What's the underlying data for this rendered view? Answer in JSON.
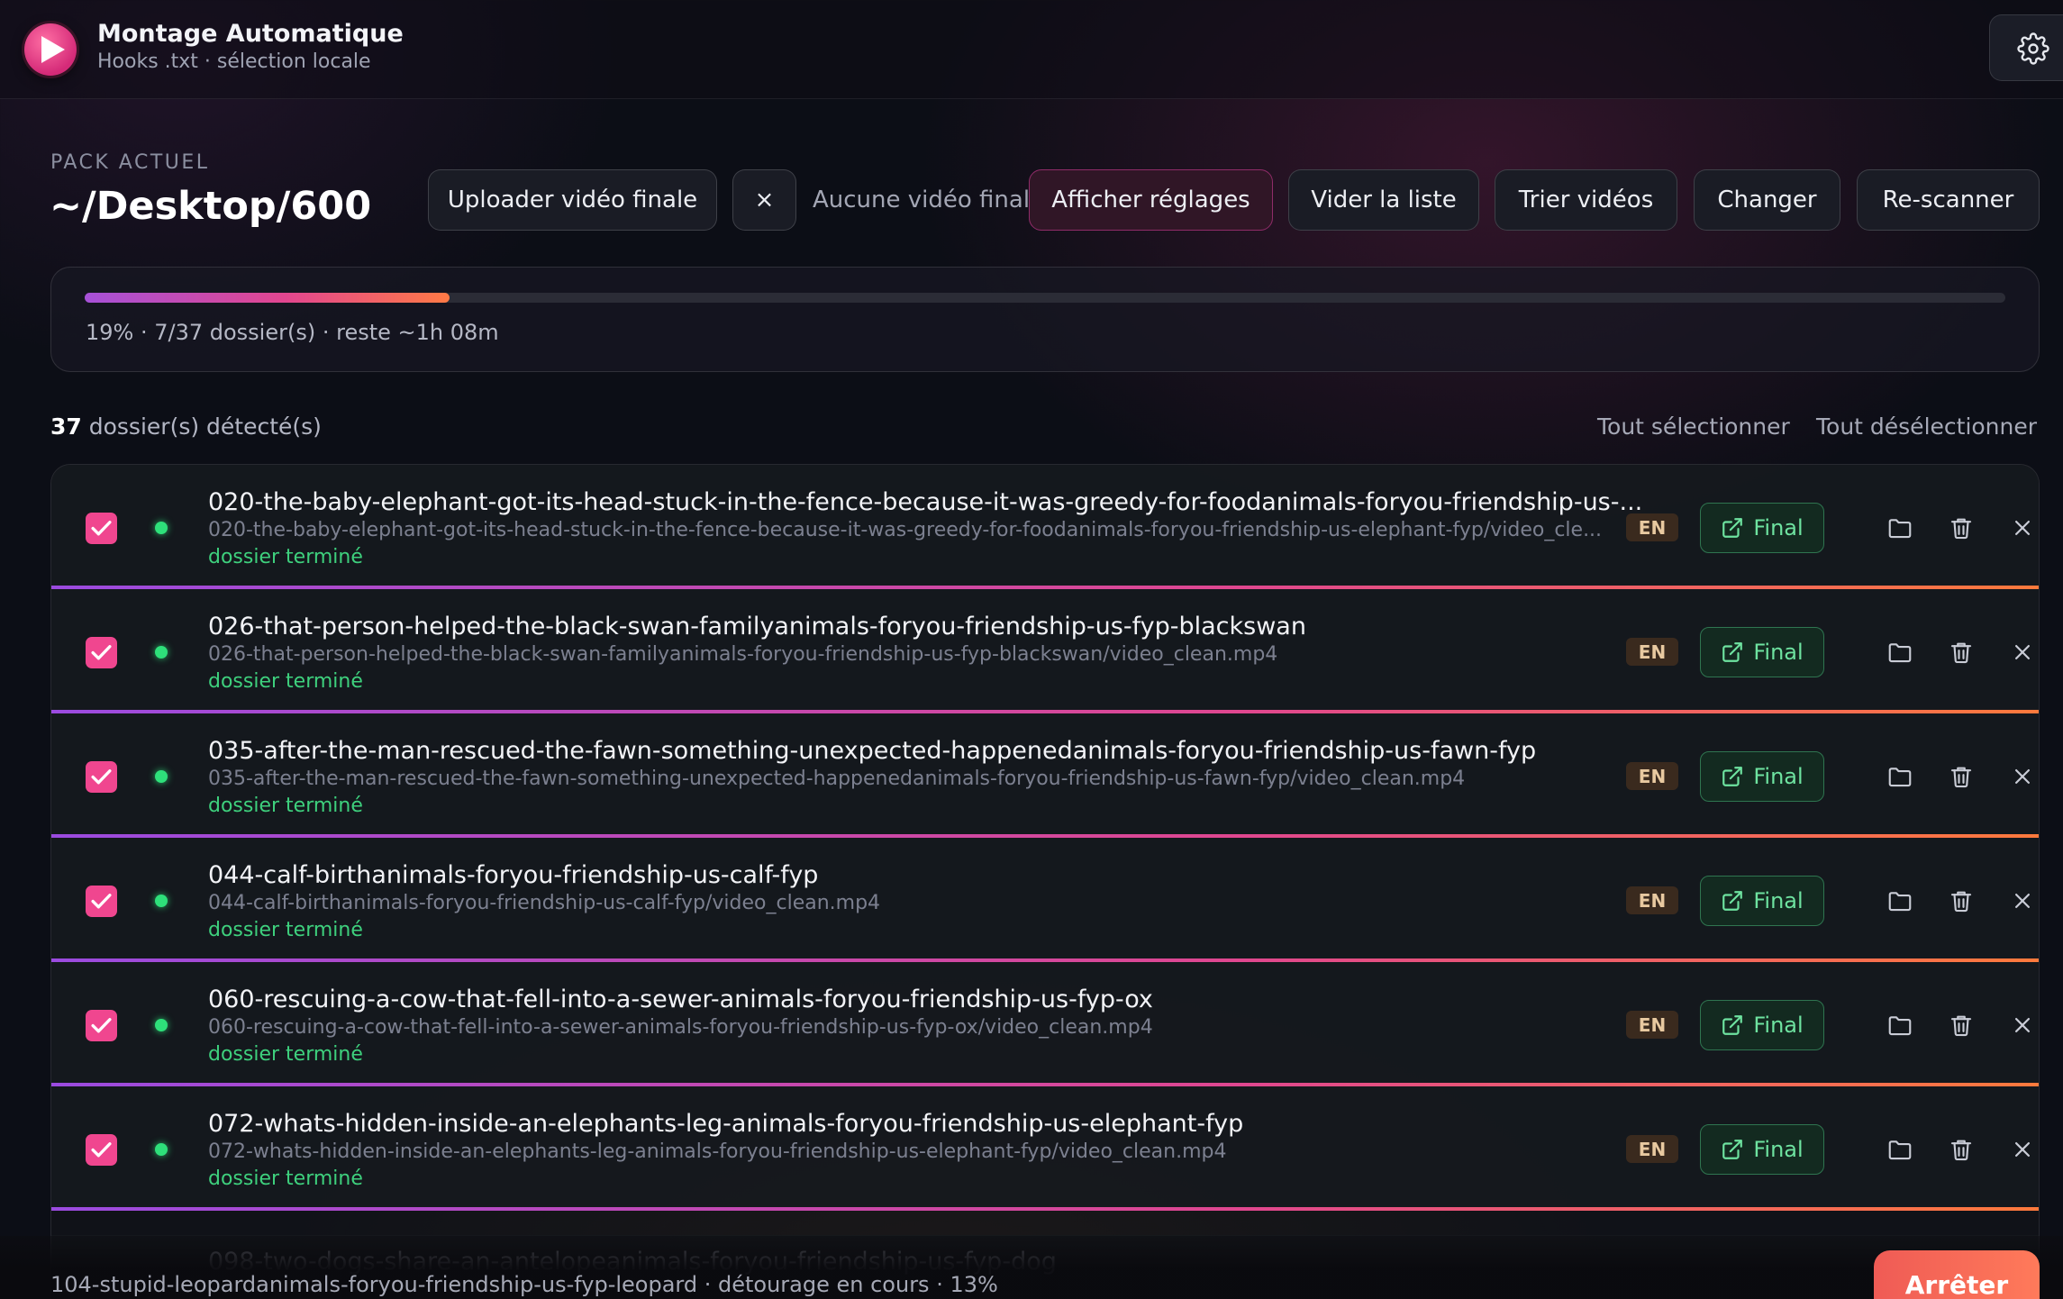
{
  "app": {
    "title": "Montage Automatique",
    "subtitle": "Hooks .txt · sélection locale"
  },
  "pack": {
    "label": "PACK ACTUEL",
    "path": "~/Desktop/600"
  },
  "toolbar": {
    "upload_label": "Uploader vidéo finale",
    "clear_label": "×",
    "no_final_text": "Aucune vidéo finale",
    "show_settings_label": "Afficher réglages",
    "clear_list_label": "Vider la liste",
    "sort_label": "Trier vidéos",
    "change_label": "Changer",
    "rescan_label": "Re-scanner"
  },
  "progress": {
    "percent": 19,
    "text": "19% · 7/37 dossier(s) · reste ~1h 08m"
  },
  "list": {
    "count": "37",
    "count_suffix": " dossier(s) détecté(s)",
    "select_all": "Tout sélectionner",
    "deselect_all": "Tout désélectionner",
    "lang": "EN",
    "final_label": "Final",
    "status_done": "dossier terminé",
    "rows": [
      {
        "title": "020-the-baby-elephant-got-its-head-stuck-in-the-fence-because-it-was-greedy-for-foodanimals-foryou-friendship-us-...",
        "path": "020-the-baby-elephant-got-its-head-stuck-in-the-fence-because-it-was-greedy-for-foodanimals-foryou-friendship-us-elephant-fyp/video_cle..."
      },
      {
        "title": "026-that-person-helped-the-black-swan-familyanimals-foryou-friendship-us-fyp-blackswan",
        "path": "026-that-person-helped-the-black-swan-familyanimals-foryou-friendship-us-fyp-blackswan/video_clean.mp4"
      },
      {
        "title": "035-after-the-man-rescued-the-fawn-something-unexpected-happenedanimals-foryou-friendship-us-fawn-fyp",
        "path": "035-after-the-man-rescued-the-fawn-something-unexpected-happenedanimals-foryou-friendship-us-fawn-fyp/video_clean.mp4"
      },
      {
        "title": "044-calf-birthanimals-foryou-friendship-us-calf-fyp",
        "path": "044-calf-birthanimals-foryou-friendship-us-calf-fyp/video_clean.mp4"
      },
      {
        "title": "060-rescuing-a-cow-that-fell-into-a-sewer-animals-foryou-friendship-us-fyp-ox",
        "path": "060-rescuing-a-cow-that-fell-into-a-sewer-animals-foryou-friendship-us-fyp-ox/video_clean.mp4"
      },
      {
        "title": "072-whats-hidden-inside-an-elephants-leg-animals-foryou-friendship-us-elephant-fyp",
        "path": "072-whats-hidden-inside-an-elephants-leg-animals-foryou-friendship-us-elephant-fyp/video_clean.mp4"
      }
    ],
    "partial_title": "098-two-dogs-share-an-antelopeanimals-foryou-friendship-us-fyp-dog"
  },
  "footer": {
    "status": "104-stupid-leopardanimals-foryou-friendship-us-fyp-leopard · détourage en cours · 13%",
    "stop_label": "Arrêter"
  },
  "colors": {
    "accent_pink": "#f0468f",
    "status_green": "#2ee07a",
    "progress_gradient": [
      "#a651d8",
      "#e2468f",
      "#ff7a45"
    ],
    "stop_button": "#ef5b55"
  },
  "icons": [
    "play-icon",
    "gear-icon",
    "check-icon",
    "external-link-icon",
    "folder-icon",
    "trash-icon",
    "close-icon"
  ]
}
